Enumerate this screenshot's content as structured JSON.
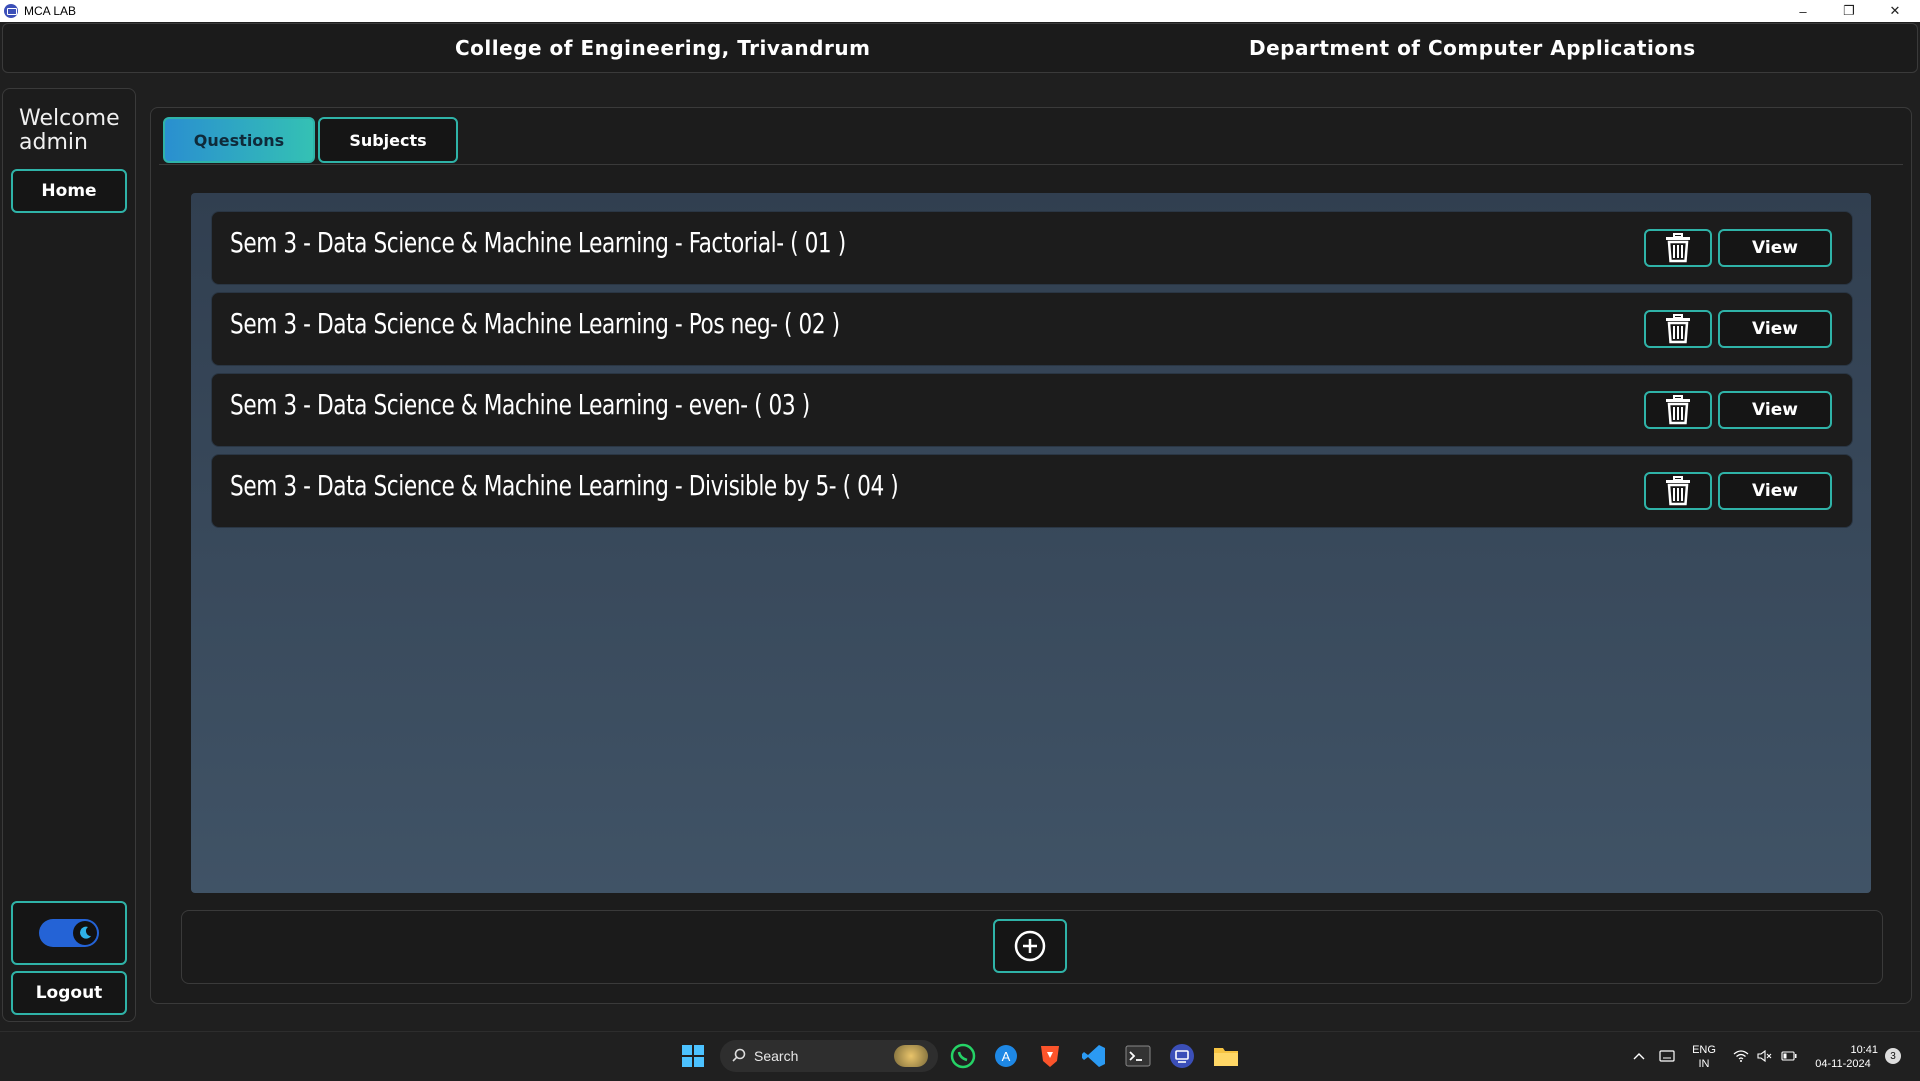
{
  "window": {
    "title": "MCA LAB",
    "controls": [
      "–",
      "❐",
      "✕"
    ]
  },
  "header": {
    "college": "College of Engineering, Trivandrum",
    "department": "Department of Computer Applications"
  },
  "sidebar": {
    "welcome_line1": "Welcome",
    "welcome_line2": "admin",
    "home_label": "Home",
    "logout_label": "Logout",
    "theme_toggle_on": true
  },
  "tabs": [
    {
      "label": "Questions",
      "active": true
    },
    {
      "label": "Subjects",
      "active": false
    }
  ],
  "questions": [
    {
      "title": "Sem 3 - Data Science & Machine Learning - Factorial- ( 01 )",
      "view_label": "View"
    },
    {
      "title": "Sem 3 - Data Science & Machine Learning - Pos neg- ( 02 )",
      "view_label": "View"
    },
    {
      "title": "Sem 3 - Data Science & Machine Learning - even- ( 03 )",
      "view_label": "View"
    },
    {
      "title": "Sem 3 - Data Science & Machine Learning - Divisible by 5- ( 04 )",
      "view_label": "View"
    }
  ],
  "taskbar": {
    "search_placeholder": "Search",
    "lang_line1": "ENG",
    "lang_line2": "IN",
    "time": "10:41",
    "date": "04-11-2024",
    "notification_count": "3"
  },
  "colors": {
    "accent": "#2fb3a8",
    "tab_active_start": "#2a8fd0",
    "tab_active_end": "#34c1b4",
    "background": "#1f1f1f",
    "content_bg": "#3a4a5c"
  }
}
